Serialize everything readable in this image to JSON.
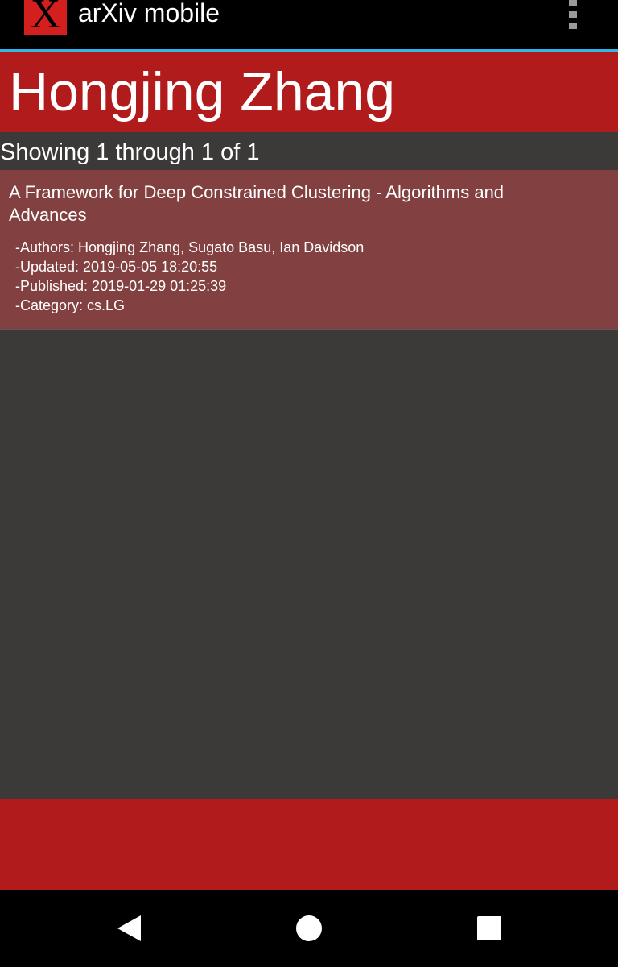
{
  "app": {
    "logo_letter": "X",
    "title": "arXiv mobile"
  },
  "header": {
    "title": "Hongjing Zhang"
  },
  "results": {
    "count_text": "Showing 1 through 1 of 1",
    "items": [
      {
        "title": "A Framework for Deep Constrained Clustering - Algorithms and Advances",
        "authors": "-Authors: Hongjing Zhang, Sugato Basu, Ian Davidson",
        "updated": "-Updated: 2019-05-05 18:20:55",
        "published": "-Published: 2019-01-29 01:25:39",
        "category": "-Category: cs.LG"
      }
    ]
  },
  "icons": {
    "logo": "arxiv-x-logo-icon",
    "menu": "overflow-menu-icon",
    "back": "back-triangle-icon",
    "home": "home-circle-icon",
    "recents": "recents-square-icon"
  },
  "colors": {
    "action_bar": "#000000",
    "accent_line": "#33b5e5",
    "header": "#b11b1b",
    "card": "#824040",
    "background": "#3b3a39",
    "logo": "#d41f1f"
  }
}
